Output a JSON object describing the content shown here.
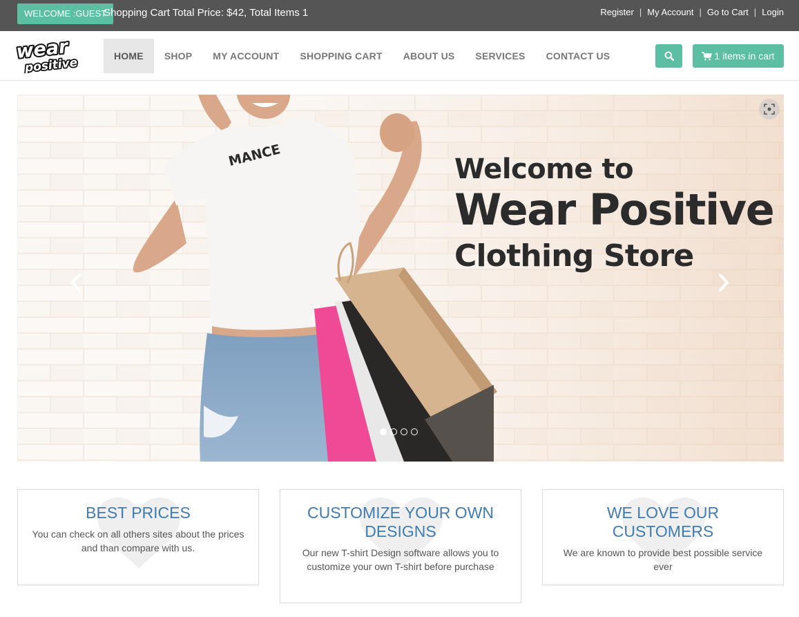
{
  "topbar": {
    "welcome": "WELCOME :GUEST",
    "cart_summary": "Shopping Cart Total Price: $42, Total Items 1",
    "links": [
      "Register",
      "My Account",
      "Go to Cart",
      "Login"
    ],
    "separator": "|"
  },
  "logo": {
    "line1": "wear",
    "line2": "positive"
  },
  "nav": {
    "items": [
      {
        "label": "HOME",
        "active": true
      },
      {
        "label": "SHOP",
        "active": false
      },
      {
        "label": "MY ACCOUNT",
        "active": false
      },
      {
        "label": "SHOPPING CART",
        "active": false
      },
      {
        "label": "ABOUT US",
        "active": false
      },
      {
        "label": "SERVICES",
        "active": false
      },
      {
        "label": "CONTACT US",
        "active": false
      }
    ],
    "cart_button": "1 items in cart",
    "search_icon": "search-icon",
    "cart_icon": "shopping-cart-icon"
  },
  "hero": {
    "line1": "Welcome to",
    "line2": "Wear Positive",
    "line3": "Clothing Store",
    "shirt_text": "MANCE",
    "slide_count": 4,
    "active_slide": 1
  },
  "features": [
    {
      "title": "BEST PRICES",
      "text": "You can check on all others sites about the prices and than compare with us."
    },
    {
      "title": "CUSTOMIZE YOUR OWN DESIGNS",
      "text": "Our new T-shirt Design software allows you to customize your own T-shirt before purchase"
    },
    {
      "title": "WE LOVE OUR CUSTOMERS",
      "text": "We are known to provide best possible service ever"
    }
  ],
  "colors": {
    "accent": "#5cbfa3",
    "topbar": "#555555",
    "feature_title": "#3f7cb0"
  }
}
